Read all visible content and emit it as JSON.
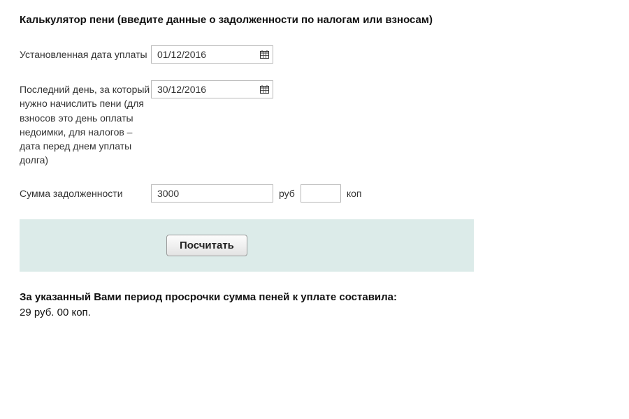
{
  "title": "Калькулятор пени (введите данные о задолженности по налогам или взносам)",
  "form": {
    "due_date": {
      "label": "Установленная дата уплаты",
      "value": "01/12/2016"
    },
    "last_day": {
      "label": "Последний день, за который нужно начислить пени (для взносов это день оплаты недоимки, для налогов – дата перед днем уплаты долга)",
      "value": "30/12/2016"
    },
    "amount": {
      "label": "Сумма задолженности",
      "rub_value": "3000",
      "rub_unit": "руб",
      "kop_value": "",
      "kop_unit": "коп"
    },
    "submit_label": "Посчитать"
  },
  "result": {
    "lead": "За указанный Вами период просрочки сумма пеней к уплате составила:",
    "value": "29 руб. 00 коп."
  }
}
